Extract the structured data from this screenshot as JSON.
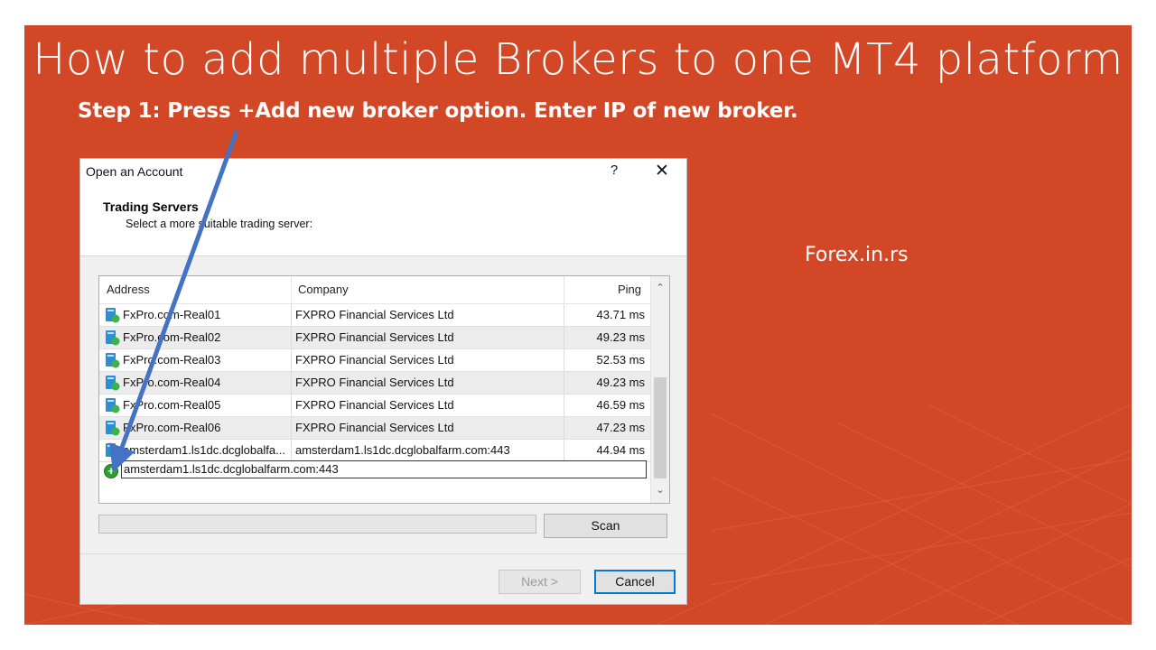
{
  "slide": {
    "title": "How to add multiple Brokers to one MT4 platform",
    "step": "Step 1: Press +Add new broker option.  Enter IP of new broker.",
    "site": "Forex.in.rs",
    "background_color": "#d24726"
  },
  "dialog": {
    "title": "Open an Account",
    "help": "?",
    "close": "✕",
    "section_title": "Trading Servers",
    "section_sub": "Select a more suitable trading server:",
    "columns": {
      "address": "Address",
      "company": "Company",
      "ping": "Ping"
    },
    "rows": [
      {
        "address": "FxPro.com-Real01",
        "company": "FXPRO Financial Services Ltd",
        "ping": "43.71 ms"
      },
      {
        "address": "FxPro.com-Real02",
        "company": "FXPRO Financial Services Ltd",
        "ping": "49.23 ms"
      },
      {
        "address": "FxPro.com-Real03",
        "company": "FXPRO Financial Services Ltd",
        "ping": "52.53 ms"
      },
      {
        "address": "FxPro.com-Real04",
        "company": "FXPRO Financial Services Ltd",
        "ping": "49.23 ms"
      },
      {
        "address": "FxPro.com-Real05",
        "company": "FXPRO Financial Services Ltd",
        "ping": "46.59 ms"
      },
      {
        "address": "FxPro.com-Real06",
        "company": "FXPRO Financial Services Ltd",
        "ping": "47.23 ms"
      },
      {
        "address": "amsterdam1.ls1dc.dcglobalfa...",
        "company": "amsterdam1.ls1dc.dcglobalfarm.com:443",
        "ping": "44.94 ms"
      }
    ],
    "new_broker_value": "amsterdam1.ls1dc.dcglobalfarm.com:443",
    "scan_label": "Scan",
    "next_label": "Next >",
    "cancel_label": "Cancel",
    "icons": {
      "server": "server-icon",
      "add": "add-broker-icon"
    },
    "accent_color": "#0078d7"
  },
  "annotation": {
    "arrow_color": "#4472c4"
  }
}
